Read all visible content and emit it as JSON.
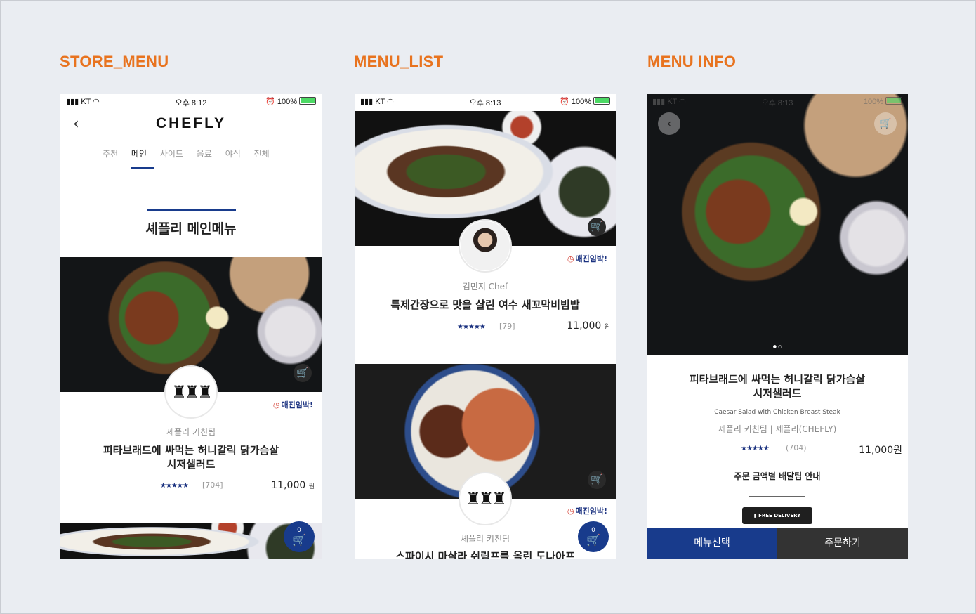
{
  "sections": {
    "store_menu": "STORE_MENU",
    "menu_list": "MENU_LIST",
    "menu_info": "MENU INFO"
  },
  "status_bar": {
    "carrier": "KT",
    "time1": "오후 8:12",
    "time2": "오후 8:13",
    "battery": "100%"
  },
  "store_menu": {
    "logo": "CHEFLY",
    "tabs": [
      "추천",
      "메인",
      "사이드",
      "음료",
      "야식",
      "전체"
    ],
    "active_tab": "메인",
    "section_heading": "셰플리 메인메뉴",
    "item": {
      "maker": "셰플리 키친팀",
      "name_line1": "피타브래드에 싸먹는 허니갈릭 닭가슴살",
      "name_line2": "시저샐러드",
      "badge": "매진임박!",
      "stars": "★★★★★",
      "reviews": "[704]",
      "price": "11,000",
      "price_unit": "원"
    },
    "cart_count": "0"
  },
  "menu_list": {
    "items": [
      {
        "maker": "김민지 Chef",
        "name": "특제간장으로 맛을 살린 여수 새꼬막비빔밥",
        "badge": "매진임박!",
        "stars": "★★★★★",
        "reviews": "[79]",
        "price": "11,000",
        "price_unit": "원"
      },
      {
        "maker": "셰플리 키친팀",
        "name": "스파이시 마살라 쉬림프를 올린 도나아프",
        "badge": "매진임박!"
      }
    ],
    "cart_count": "0"
  },
  "menu_info": {
    "name_line1": "피타브래드에 싸먹는 허니갈릭 닭가슴살",
    "name_line2": "시저샐러드",
    "english_name": "Caesar Salad with Chicken Breast Steak",
    "store": "셰플리 키친팀 | 셰플리(CHEFLY)",
    "stars": "★★★★★",
    "reviews": "(704)",
    "price": "11,000원",
    "delivery_guide": "주문 금액별 배달팁 안내",
    "free_delivery": "FREE DELIVERY",
    "btn_select": "메뉴선택",
    "btn_order": "주문하기"
  },
  "colors": {
    "accent_orange": "#e8731f",
    "brand_navy": "#183b8c",
    "dark_button": "#333333",
    "soldout_red": "#d23a2e"
  }
}
